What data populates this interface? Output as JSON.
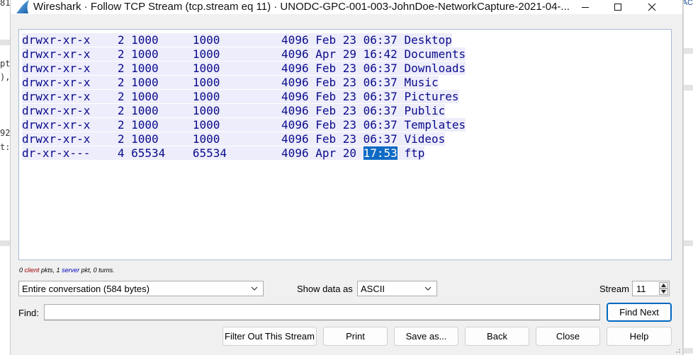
{
  "window": {
    "title": "Wireshark · Follow TCP Stream (tcp.stream eq 11) · UNODC-GPC-001-003-JohnDoe-NetworkCapture-2021-04-...",
    "icon": "wireshark-fin-icon"
  },
  "background": {
    "left_fragments": [
      "81",
      "pt",
      "),",
      "92",
      "t:"
    ],
    "right_fragments": [
      "AC"
    ]
  },
  "stream": {
    "lines": [
      {
        "pre": "",
        "text": "drwxr-xr-x    2 1000     1000         4096 Feb 23 06:37 Desktop",
        "sel": "",
        "post": ""
      },
      {
        "pre": "",
        "text": "drwxr-xr-x    2 1000     1000         4096 Apr 29 16:42 Documents",
        "sel": "",
        "post": ""
      },
      {
        "pre": "",
        "text": "drwxr-xr-x    2 1000     1000         4096 Feb 23 06:37 Downloads",
        "sel": "",
        "post": ""
      },
      {
        "pre": "",
        "text": "drwxr-xr-x    2 1000     1000         4096 Feb 23 06:37 Music",
        "sel": "",
        "post": ""
      },
      {
        "pre": "",
        "text": "drwxr-xr-x    2 1000     1000         4096 Feb 23 06:37 Pictures",
        "sel": "",
        "post": ""
      },
      {
        "pre": "",
        "text": "drwxr-xr-x    2 1000     1000         4096 Feb 23 06:37 Public",
        "sel": "",
        "post": ""
      },
      {
        "pre": "",
        "text": "drwxr-xr-x    2 1000     1000         4096 Feb 23 06:37 Templates",
        "sel": "",
        "post": ""
      },
      {
        "pre": "",
        "text": "drwxr-xr-x    2 1000     1000         4096 Feb 23 06:37 Videos",
        "sel": "",
        "post": ""
      },
      {
        "pre": "dr-xr-x---    4 65534    65534        4096 Apr 20 ",
        "text": "",
        "sel": "17:53",
        "post": " ftp"
      }
    ]
  },
  "stats": {
    "client_count": "0",
    "client_word": "client",
    "mid": " pkts, 1 ",
    "server_word": "server",
    "tail": " pkt, 0 turns."
  },
  "controls": {
    "conversation": "Entire conversation (584 bytes)",
    "show_data_label": "Show data as",
    "format": "ASCII",
    "stream_label": "Stream",
    "stream_value": "11",
    "find_label": "Find:",
    "find_value": "",
    "find_next": "Find Next"
  },
  "buttons": {
    "filter_out": "Filter Out This Stream",
    "print": "Print",
    "save_as": "Save as...",
    "back": "Back",
    "close": "Close",
    "help": "Help"
  },
  "colors": {
    "client_text": "#0a0a8c",
    "client_bg": "#ededfb",
    "selection": "#0f6ac4",
    "stats_client": "#a00000",
    "stats_server": "#0000c0"
  }
}
